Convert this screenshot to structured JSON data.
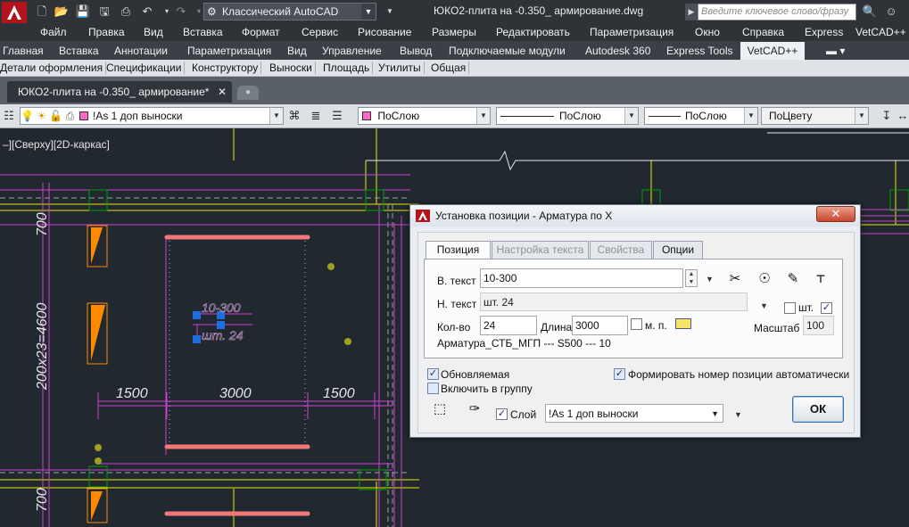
{
  "titlebar": {
    "workspace": "Классический AutoCAD",
    "document_title": "ЮКО2-плита на -0.350_ армирование.dwg",
    "search_placeholder": "Введите ключевое слово/фразу"
  },
  "menu": [
    "Файл",
    "Правка",
    "Вид",
    "Вставка",
    "Формат",
    "Сервис",
    "Рисование",
    "Размеры",
    "Редактировать",
    "Параметризация",
    "Окно",
    "Справка",
    "Express",
    "VetCAD++"
  ],
  "ribbon_tabs": [
    "Главная",
    "Вставка",
    "Аннотации",
    "Параметризация",
    "Вид",
    "Управление",
    "Вывод",
    "Подключаемые модули",
    "Autodesk 360",
    "Express Tools",
    "VetCAD++"
  ],
  "ribbon_active": "VetCAD++",
  "panel_tabs": [
    "Детали оформления",
    "Спецификации",
    "Конструктору",
    "Выноски",
    "Площадь",
    "Утилиты",
    "Общая"
  ],
  "file_tab": {
    "label": "ЮКО2-плита на -0.350_ армирование*",
    "close": "✕"
  },
  "properties_toolbar": {
    "layer": "!As 1 доп  выноски",
    "color": "ПоСлою",
    "linetype": "ПоСлою",
    "lineweight": "ПоСлою",
    "plotstyle": "ПоЦвету"
  },
  "viewport_label": "–][Сверху][2D-каркас]",
  "drawing": {
    "dim_700_top": "700",
    "dim_vertical": "200x23=4600",
    "dim_700_bottom": "700",
    "dim_1500_left": "1500",
    "dim_3000": "3000",
    "dim_1500_right": "1500",
    "tag_top": "10-300",
    "tag_bottom": "шт. 24",
    "colors": {
      "background": "#212830",
      "magenta": "#d040d0",
      "yellow": "#e8e800",
      "rebar": "#f07878",
      "orange": "#ff8a00",
      "green": "#00a000"
    }
  },
  "dialog": {
    "title": "Установка позиции - Арматура по X",
    "close": "✕",
    "tabs": [
      "Позиция",
      "Настройка текста",
      "Свойства",
      "Опции"
    ],
    "active_tab": "Позиция",
    "v_text_label": "В. текст",
    "v_text_value": "10-300",
    "n_text_label": "Н. текст",
    "n_text_value": "шт. 24",
    "qty_label": "Кол-во",
    "qty_value": "24",
    "length_label": "Длина",
    "length_value": "3000",
    "mp_label": "м. п.",
    "sht_label": "шт.",
    "scale_label": "Масштаб",
    "scale_value": "100",
    "info": "Арматура_СТБ_МГП  ---  S500  ---  10",
    "updatable_label": "Обновляемая",
    "group_label": "Включить в группу",
    "auto_number_label": "Формировать номер позиции автоматически",
    "layer_label": "Слой",
    "layer_value": "!As 1 доп  выноски",
    "ok": "ОК",
    "check_mark": "✓"
  }
}
